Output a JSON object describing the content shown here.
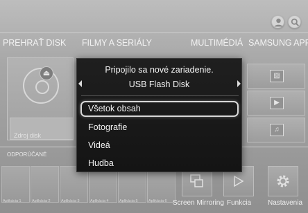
{
  "hub": {
    "sections": {
      "disk": "PREHRAŤ DISK",
      "films": "FILMY A SERIÁLY",
      "multimedia": "MULTIMÉDIÁ",
      "apps": "SAMSUNG APPS"
    },
    "sources_label": "Zdroj disk",
    "recommended_label": "ODPORÚČANÉ",
    "apps": [
      "Aplikácia 1",
      "Aplikácia 2",
      "Aplikácia 3",
      "Aplikácia 4",
      "Aplikácia 5",
      "Aplikácia 6"
    ],
    "tiles": {
      "screen_mirroring": "Screen Mirroring",
      "function": "Funkcia",
      "settings": "Nastavenia"
    },
    "icons": [
      "user-icon",
      "search-icon",
      "disk-icon",
      "photo-icon",
      "video-icon",
      "music-icon",
      "screen-mirroring-icon",
      "function-icon",
      "gear-icon"
    ]
  },
  "popup": {
    "title": "Pripojilo sa nové zariadenie.",
    "device": "USB Flash Disk",
    "items": [
      {
        "label": "Všetok obsah",
        "selected": true
      },
      {
        "label": "Fotografie",
        "selected": false
      },
      {
        "label": "Videá",
        "selected": false
      },
      {
        "label": "Hudba",
        "selected": false
      }
    ]
  }
}
